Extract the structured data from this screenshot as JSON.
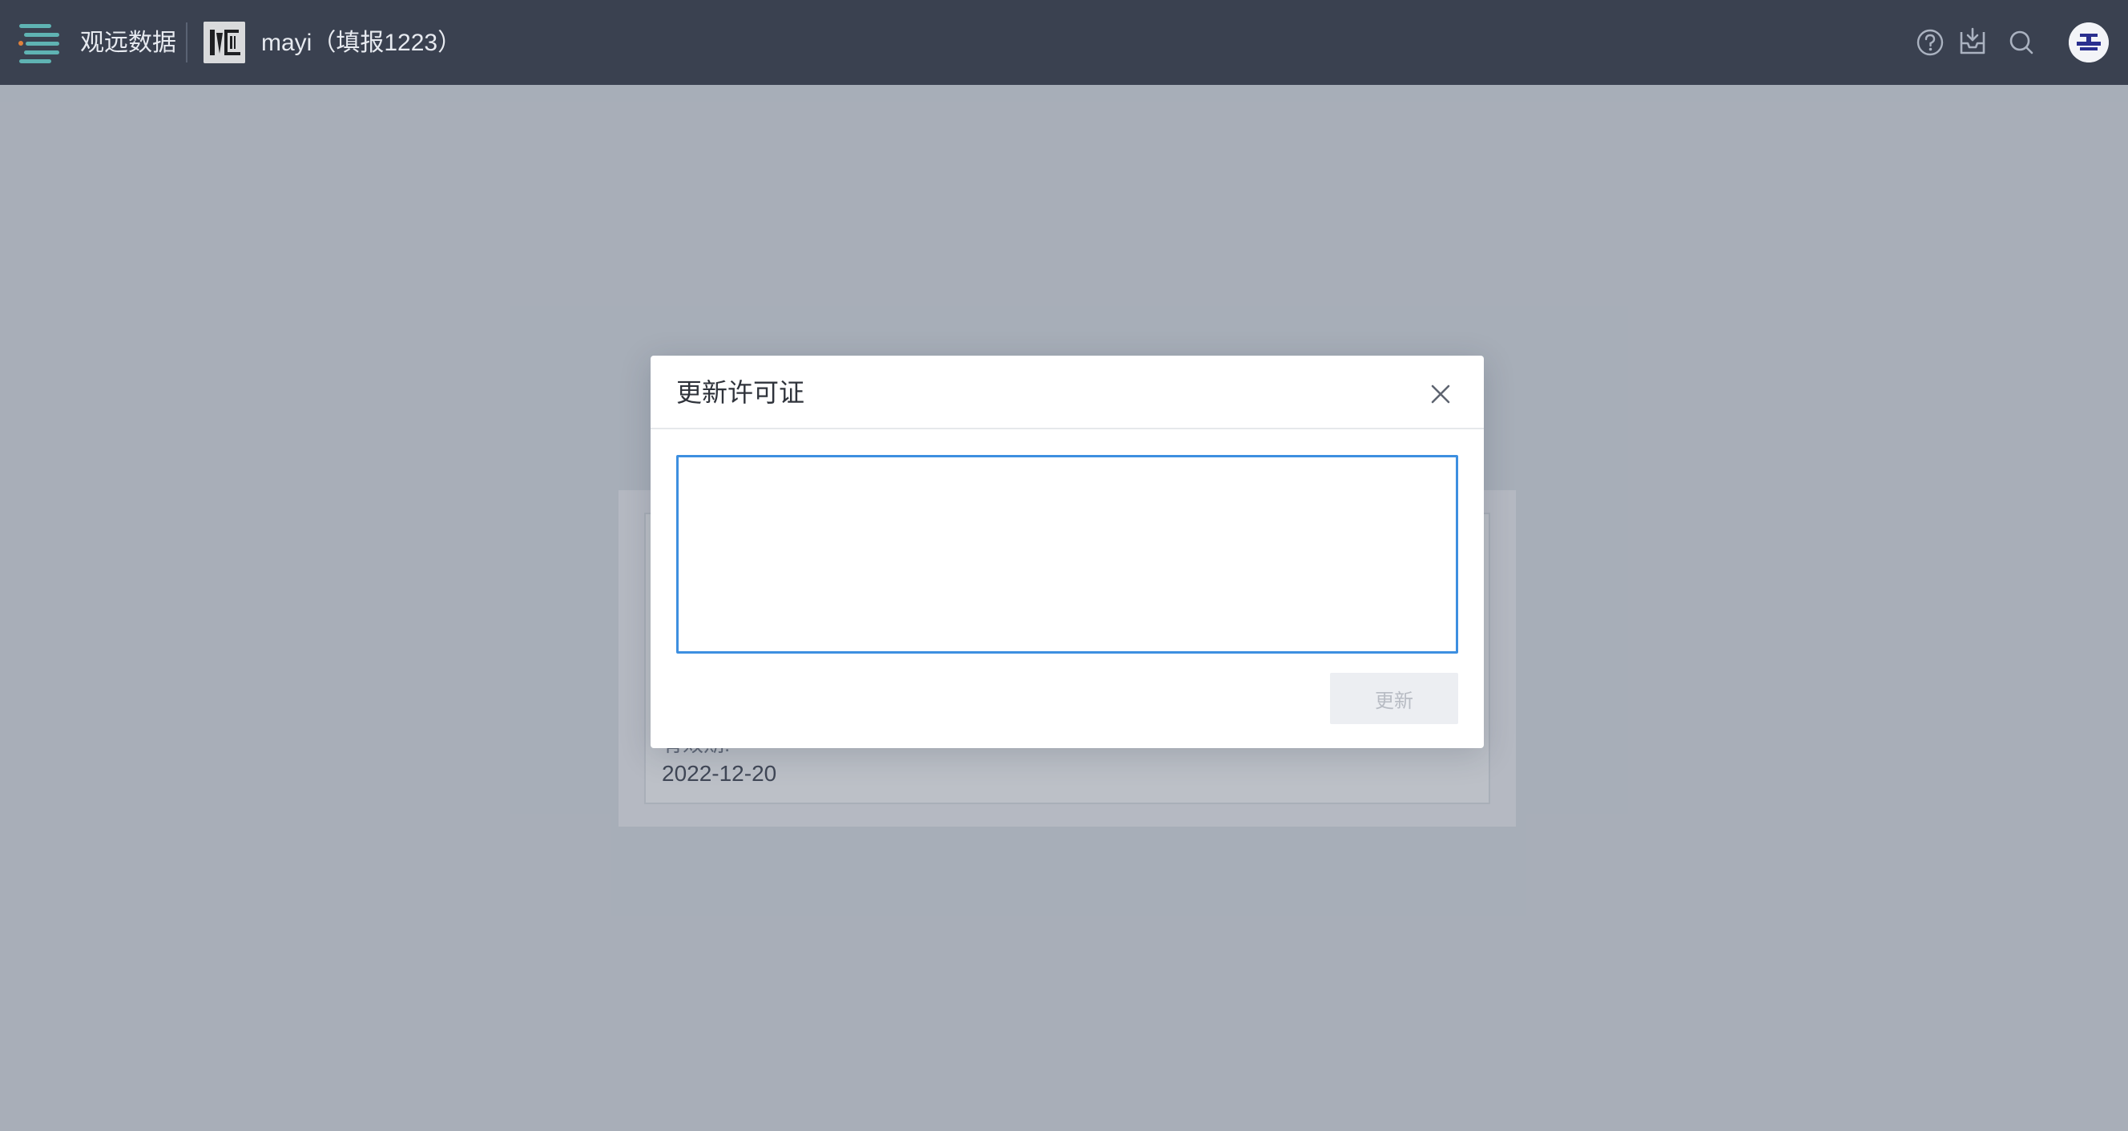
{
  "header": {
    "brand": "观远数据",
    "project_name": "mayi（填报1223）",
    "menu_icon": "menu-icon",
    "help_icon": "help-icon",
    "inbox_icon": "inbox-download-icon",
    "search_icon": "search-icon",
    "avatar_icon": "user-avatar",
    "colors": {
      "bar_background": "#3a4150",
      "menu_accent": "#5fb3b3",
      "menu_dot": "#e0813b"
    }
  },
  "background_card": {
    "validity_label": "有效期:",
    "validity_value": "2022-12-20"
  },
  "modal": {
    "title": "更新许可证",
    "close_icon": "close-icon",
    "input_value": "",
    "input_placeholder": "",
    "update_button_label": "更新",
    "update_button_state": "disabled",
    "input_focus_color": "#3d8fe0"
  }
}
